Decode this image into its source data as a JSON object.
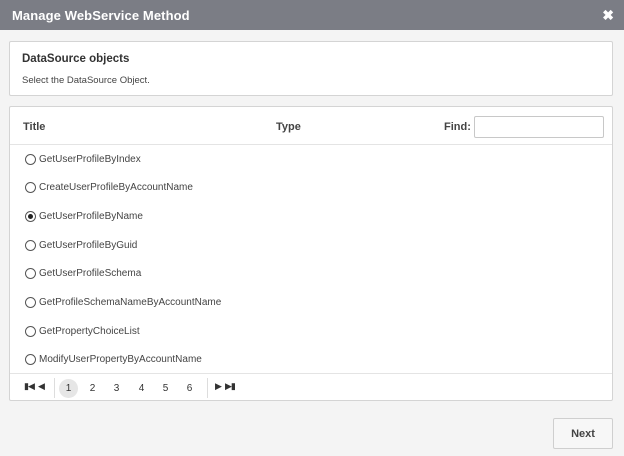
{
  "dialog": {
    "title": "Manage WebService Method",
    "close_glyph": "✖"
  },
  "info": {
    "heading": "DataSource objects",
    "description": "Select the DataSource Object."
  },
  "grid": {
    "columns": {
      "title": "Title",
      "type": "Type"
    },
    "find": {
      "label": "Find:",
      "value": ""
    },
    "rows": [
      {
        "label": "GetUserProfileByIndex",
        "selected": false
      },
      {
        "label": "CreateUserProfileByAccountName",
        "selected": false
      },
      {
        "label": "GetUserProfileByName",
        "selected": true
      },
      {
        "label": "GetUserProfileByGuid",
        "selected": false
      },
      {
        "label": "GetUserProfileSchema",
        "selected": false
      },
      {
        "label": "GetProfileSchemaNameByAccountName",
        "selected": false
      },
      {
        "label": "GetPropertyChoiceList",
        "selected": false
      },
      {
        "label": "ModifyUserPropertyByAccountName",
        "selected": false
      }
    ]
  },
  "pager": {
    "first_glyph": "▮◀",
    "prev_glyph": "◀",
    "next_glyph": "▶",
    "last_glyph": "▶▮",
    "pages": [
      "1",
      "2",
      "3",
      "4",
      "5",
      "6"
    ],
    "current_page": "1"
  },
  "footer": {
    "next_label": "Next"
  },
  "colors": {
    "titlebar": "#7b7d85",
    "panel_border": "#d4d4d4",
    "background": "#f4f4f4"
  }
}
